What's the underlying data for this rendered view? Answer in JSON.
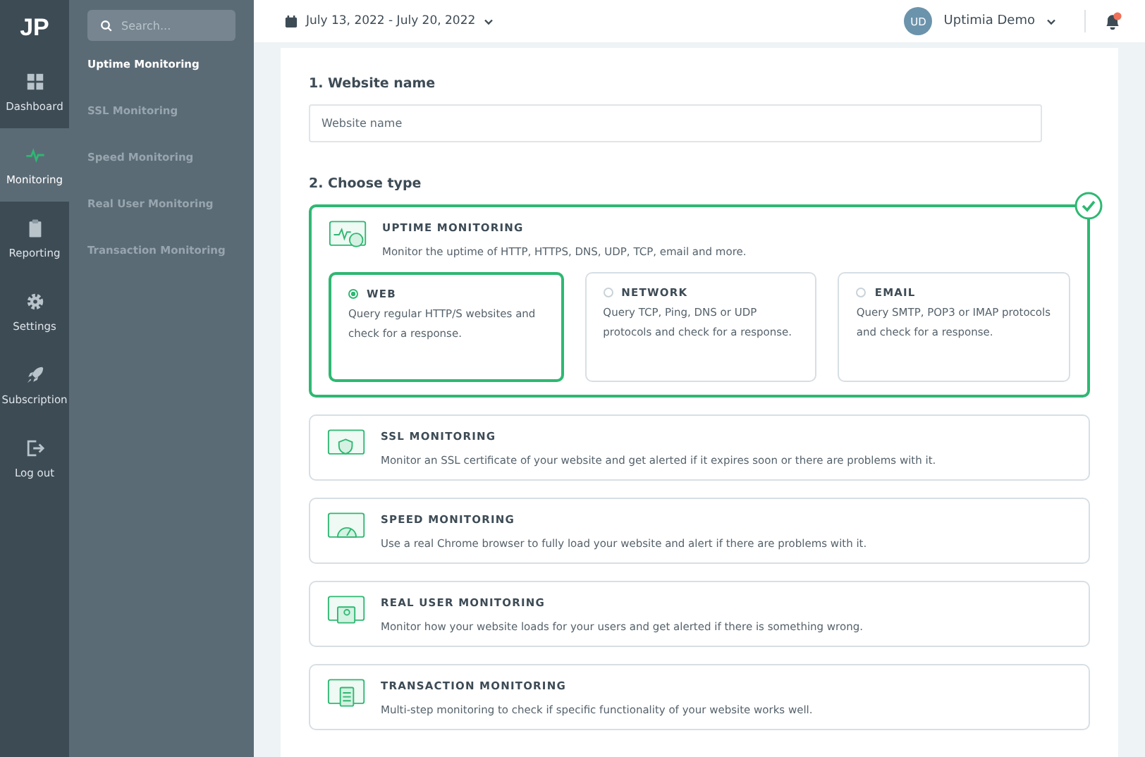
{
  "logo": "JP",
  "nav": [
    {
      "label": "Dashboard",
      "kind": "grid",
      "selected": false
    },
    {
      "label": "Monitoring",
      "kind": "pulse",
      "selected": true
    },
    {
      "label": "Reporting",
      "kind": "clipboard",
      "selected": false
    },
    {
      "label": "Settings",
      "kind": "gear",
      "selected": false
    },
    {
      "label": "Subscription",
      "kind": "rocket",
      "selected": false
    },
    {
      "label": "Log out",
      "kind": "logout",
      "selected": false
    }
  ],
  "search": {
    "placeholder": "Search..."
  },
  "submenu": [
    {
      "label": "Uptime Monitoring",
      "selected": true
    },
    {
      "label": "SSL Monitoring",
      "selected": false
    },
    {
      "label": "Speed Monitoring",
      "selected": false
    },
    {
      "label": "Real User Monitoring",
      "selected": false
    },
    {
      "label": "Transaction Monitoring",
      "selected": false
    }
  ],
  "header": {
    "date_range": "July 13, 2022 - July 20, 2022",
    "avatar": "UD",
    "user": "Uptimia Demo",
    "notification": true
  },
  "form": {
    "name_title": "1. Website name",
    "name_field": {
      "placeholder": "Website name"
    },
    "type_title": "2. Choose type",
    "types": [
      {
        "kind": "uptime",
        "title": "UPTIME MONITORING",
        "description": "Monitor the uptime of HTTP, HTTPS, DNS, UDP, TCP, email and more.",
        "selected": true,
        "options": [
          {
            "title": "WEB",
            "description": "Query regular HTTP/S websites and check for a response.",
            "selected": true
          },
          {
            "title": "NETWORK",
            "description": "Query TCP, Ping, DNS or UDP protocols and check for a response.",
            "selected": false
          },
          {
            "title": "EMAIL",
            "description": "Query SMTP, POP3 or IMAP protocols and check for a response.",
            "selected": false
          }
        ]
      },
      {
        "kind": "ssl",
        "title": "SSL MONITORING",
        "description": "Monitor an SSL certificate of your website and get alerted if it expires soon or there are problems with it.",
        "selected": false
      },
      {
        "kind": "speed",
        "title": "SPEED MONITORING",
        "description": "Use a real Chrome browser to fully load your website and alert if there are problems with it.",
        "selected": false
      },
      {
        "kind": "user",
        "title": "REAL USER MONITORING",
        "description": "Monitor how your website loads for your users and get alerted if there is something wrong.",
        "selected": false
      },
      {
        "kind": "transaction",
        "title": "TRANSACTION MONITORING",
        "description": "Multi-step monitoring to check if specific functionality of your website works well.",
        "selected": false
      }
    ]
  }
}
